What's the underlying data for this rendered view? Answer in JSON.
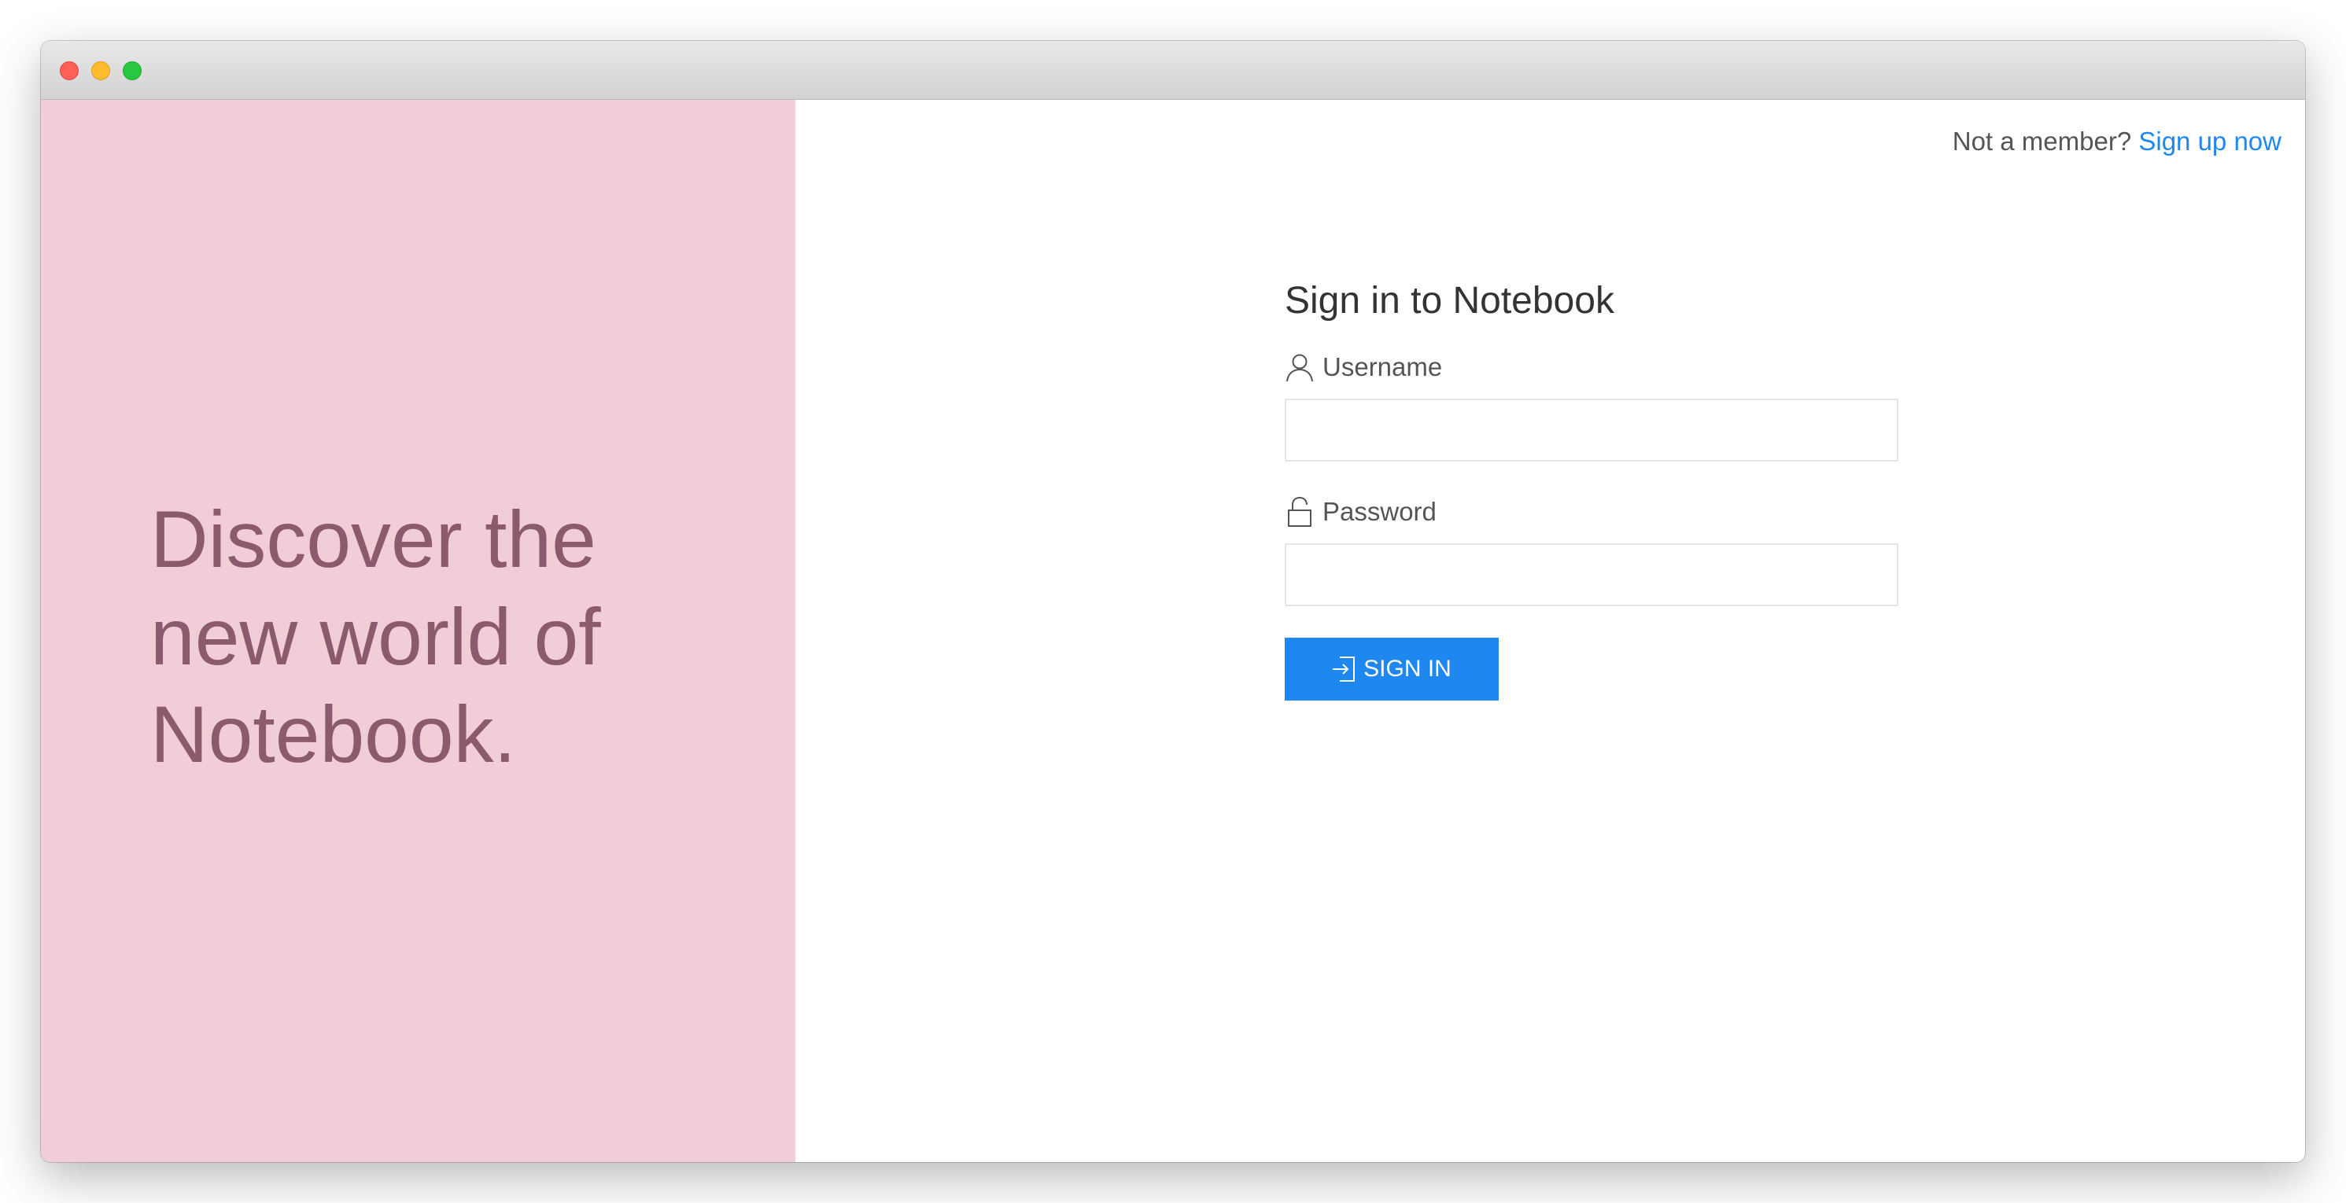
{
  "left_panel": {
    "tagline": "Discover the\nnew world of\nNotebook.",
    "background_color": "#f0cdd7",
    "text_color": "#8b5a6d"
  },
  "header": {
    "member_prompt": "Not a member?",
    "signup_link": "Sign up now"
  },
  "form": {
    "title": "Sign in to Notebook",
    "username_label": "Username",
    "username_value": "",
    "username_icon": "user-icon",
    "password_label": "Password",
    "password_value": "",
    "password_icon": "unlock-icon",
    "submit_label": "SIGN IN",
    "submit_icon": "sign-in-icon",
    "accent_color": "#1e87f0"
  }
}
